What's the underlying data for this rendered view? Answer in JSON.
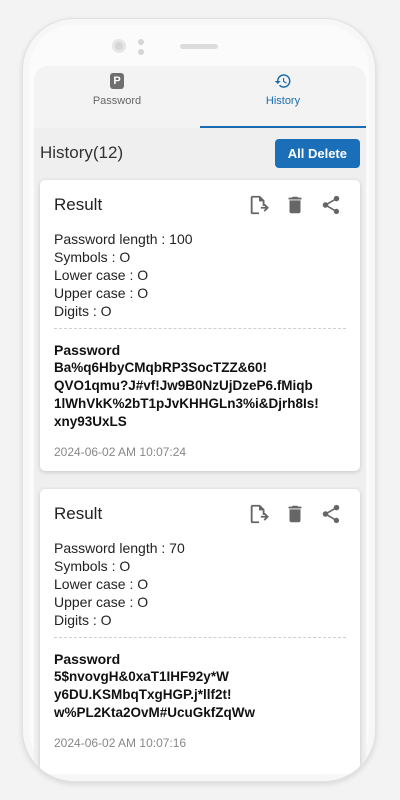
{
  "tabs": [
    {
      "label": "Password",
      "icon": "parking-p-icon"
    },
    {
      "label": "History",
      "icon": "history-icon"
    }
  ],
  "history": {
    "title": "History(12)",
    "all_delete_label": "All Delete"
  },
  "cards": [
    {
      "title": "Result",
      "params": [
        "Password length : 100",
        "Symbols : O",
        "Lower case : O",
        "Upper case : O",
        "Digits : O"
      ],
      "password_label": "Password",
      "password_lines": [
        "Ba%q6HbyCMqbRP3SocTZZ&60!",
        "QVO1qmu?J#vf!Jw9B0NzUjDzeP6.fMiqb",
        "1lWhVkK%2bT1pJvKHHGLn3%i&Djrh8Is!",
        "xny93UxLS"
      ],
      "timestamp": "2024-06-02 AM 10:07:24"
    },
    {
      "title": "Result",
      "params": [
        "Password length : 70",
        "Symbols : O",
        "Lower case : O",
        "Upper case : O",
        "Digits : O"
      ],
      "password_label": "Password",
      "password_lines": [
        "5$nvovgH&0xaT1IHF92y*W",
        "y6DU.KSMbqTxgHGP.j*llf2t!",
        "w%PL2Kta2OvM#UcuGkfZqWw"
      ],
      "timestamp": "2024-06-02 AM 10:07:16"
    }
  ],
  "colors": {
    "accent": "#1a6fb8",
    "icon_gray": "#666666"
  }
}
